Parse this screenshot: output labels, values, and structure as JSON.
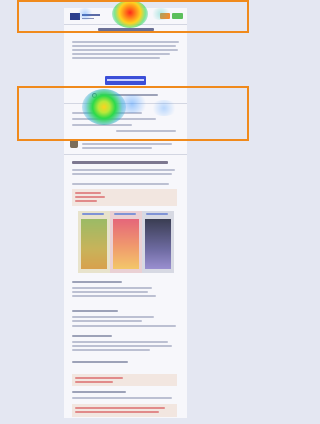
{
  "view": {
    "type": "heatmap-overlay",
    "frame_color": "#f08a1c",
    "heat_colors": [
      "#ff2a1a",
      "#ffd21f",
      "#2bd94a",
      "#2a8cff"
    ]
  },
  "page": {
    "header_buttons": [
      "orange-button",
      "green-button"
    ],
    "cta_color": "#3c4fd8",
    "panel_colors": [
      "#7fa346",
      "#e25b6b",
      "#3a3d52"
    ]
  }
}
